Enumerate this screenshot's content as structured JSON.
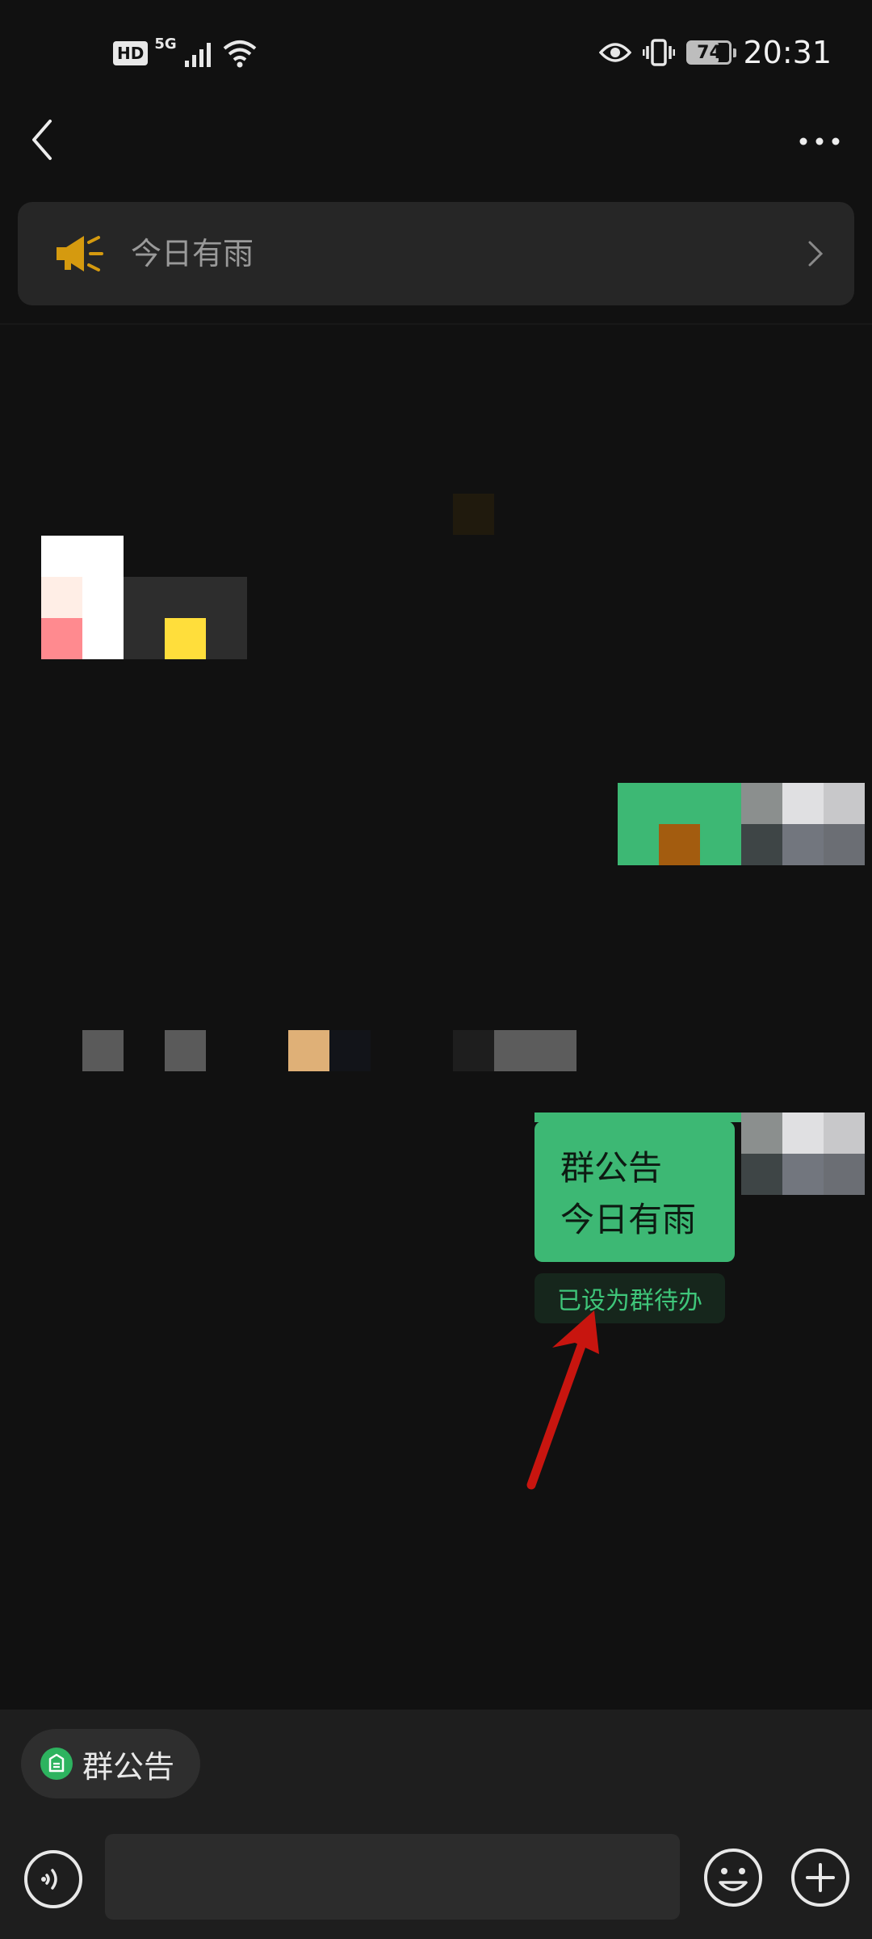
{
  "status_bar": {
    "hd": "HD",
    "network": "5G",
    "battery_level": "74",
    "battery_fraction": 0.74,
    "time": "20:31",
    "icons": [
      "signal-icon",
      "wifi-icon",
      "eye-icon",
      "vibrate-icon",
      "battery-icon"
    ]
  },
  "header": {
    "back_icon": "back-chevron-icon",
    "more_icon": "more-dots-icon"
  },
  "notice": {
    "icon": "megaphone-icon",
    "text": "今日有雨",
    "chevron": "chevron-right-icon",
    "accent": "#d59a0f"
  },
  "message": {
    "title": "群公告",
    "body": "今日有雨",
    "status": "已设为群待办",
    "bubble_color": "#3db874"
  },
  "quick_action": {
    "label": "群公告",
    "icon": "announcement-icon",
    "icon_color": "#2db35f"
  },
  "input_bar": {
    "voice_icon": "voice-icon",
    "placeholder": "",
    "emoji_icon": "emoji-icon",
    "plus_icon": "plus-icon"
  },
  "annotation": {
    "arrow_color": "#c8150f"
  }
}
